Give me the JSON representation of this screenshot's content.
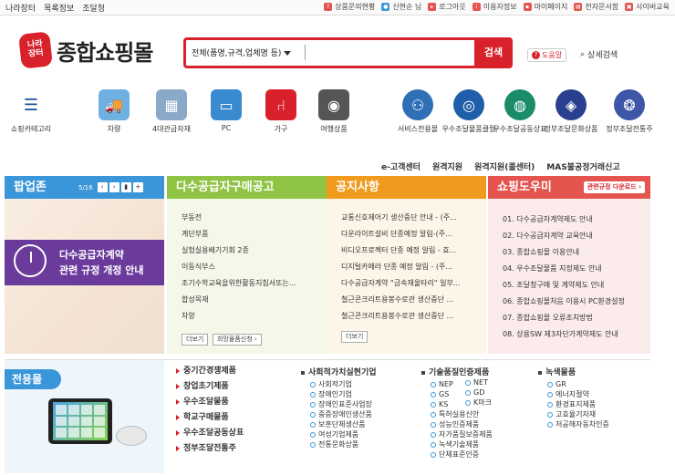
{
  "topbar": {
    "left": [
      "나라장터",
      "목록정보",
      "조달청"
    ],
    "right": [
      {
        "label": "상품문의현황",
        "icon": "question-icon",
        "color": "#e4554f"
      },
      {
        "label": "신현순 님",
        "icon": "user-icon",
        "color": "#3a96d8"
      },
      {
        "label": "로그아웃",
        "icon": "logout-icon",
        "color": "#e4554f"
      },
      {
        "label": "이용자정보",
        "icon": "info-icon",
        "color": "#e4554f"
      },
      {
        "label": "마이페이지",
        "icon": "mypage-icon",
        "color": "#e4554f"
      },
      {
        "label": "전자문서함",
        "icon": "document-icon",
        "color": "#e4554f"
      },
      {
        "label": "사이버교육",
        "icon": "education-icon",
        "color": "#e4554f"
      }
    ]
  },
  "logo": {
    "badge_line1": "나라",
    "badge_line2": "장터",
    "text": "종합쇼핑몰"
  },
  "search": {
    "select_label": "전체(품명,규격,업체명 등)",
    "placeholder": "",
    "button": "검색"
  },
  "help": {
    "label": "도움말"
  },
  "detail_search": {
    "label": "상세검색"
  },
  "categories": [
    {
      "label": "쇼핑카테고리",
      "icon": "list-icon"
    },
    {
      "label": "차량",
      "icon": "truck-icon"
    },
    {
      "label": "4대관급자재",
      "icon": "materials-icon"
    },
    {
      "label": "PC",
      "icon": "pc-icon"
    },
    {
      "label": "가구",
      "icon": "chair-icon"
    },
    {
      "label": "여행상품",
      "icon": "camera-icon"
    },
    {
      "label": "서비스전용몰",
      "icon": "service-icon"
    },
    {
      "label": "우수조달물품클럽",
      "icon": "excellent-icon"
    },
    {
      "label": "우수조달공동상표",
      "icon": "brand-icon"
    },
    {
      "label": "정부조달문화상품",
      "icon": "culture-icon"
    },
    {
      "label": "정부조달전통주",
      "icon": "liquor-icon"
    }
  ],
  "submenu": [
    "e-고객센터",
    "원격지원",
    "원격지원(콜센터)",
    "MAS불공정거래신고"
  ],
  "popup": {
    "title": "팝업존",
    "counter": "5/16",
    "line1": "다수공급자계약",
    "line2": "관련 규정 개정 안내"
  },
  "notice_mas": {
    "title": "다수공급자구매공고",
    "items": [
      "부동전",
      "계단부품",
      "실험실용배기기회 2종",
      "이동식부스",
      "조기수학교육을위한활동지침서또는...",
      "합성목재",
      "차양"
    ],
    "more": "더보기",
    "request": "희망물품신청"
  },
  "notice": {
    "title": "공지사항",
    "items": [
      "교통신호제어기 생산중단 안내 - (주...",
      "다운라이트설비 단종예정 알림-(주...",
      "비디오프로젝터 단종 예정 알림 - 효...",
      "디지털카메라 단종 예정 알림 - (주...",
      "다수공급자계약 \"금속재울타리\" 일부...",
      "철근콘크리트용봉수로관 생산중단 ...",
      "철근콘크리트용봉수로관 생산중단 ..."
    ],
    "more": "더보기"
  },
  "shopping_help": {
    "title": "쇼핑도우미",
    "download": "관련규정 다운로드",
    "items": [
      "01. 다수공급자계약제도 안내",
      "02. 다수공급자계약 교육안내",
      "03. 종합쇼핑몰 이용안내",
      "04. 우수조달물품 지정제도 안내",
      "05. 조달청구매 및 계약제도 안내",
      "06. 종합쇼핑몰처음 이용시 PC환경설정",
      "07. 종합쇼핑몰 오류조치방법",
      "08. 상용SW 제3자단가계약제도 안내"
    ]
  },
  "bottom": {
    "title": "전용몰",
    "col1": [
      "중기간경쟁제품",
      "창업초기제품",
      "우수조달물품",
      "학교구매물품",
      "우수조달공동상표",
      "정부조달전통주"
    ],
    "col2": {
      "head": "사회적가치실현기업",
      "items": [
        "사회적기업",
        "장애인기업",
        "장애인표준사업장",
        "중증장애인생산품",
        "보훈단체생산품",
        "여성기업제품",
        "전통문화상품"
      ]
    },
    "col3": {
      "head": "기술품질인증제품",
      "left": [
        "NEP",
        "GS",
        "KS",
        "특허실용신안",
        "성능인증제품",
        "자가품질보증제품",
        "녹색기술제품",
        "단체표준인증"
      ],
      "right": [
        "NET",
        "GD",
        "K마크"
      ]
    },
    "col4": {
      "head": "녹색물품",
      "items": [
        "GR",
        "에너지절약",
        "환경표지제품",
        "고효율기자재",
        "저공해자동차인증"
      ]
    }
  }
}
